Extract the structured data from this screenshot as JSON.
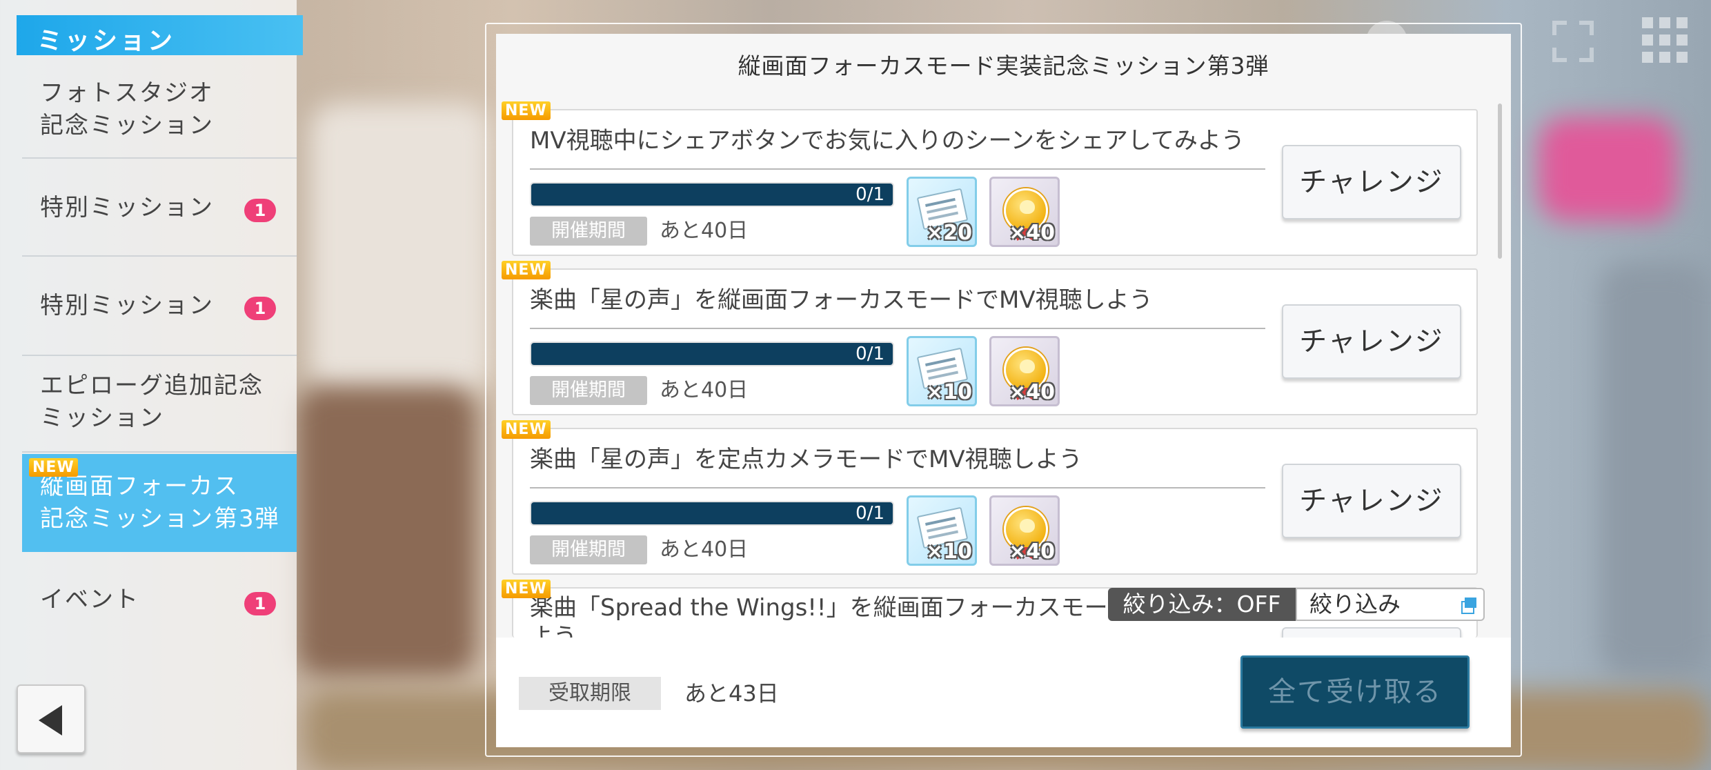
{
  "sidebar": {
    "header": "ミッション",
    "items": [
      {
        "label_lines": [
          "フォトスタジオ",
          "記念ミッション"
        ],
        "badge": null,
        "new": false
      },
      {
        "label_lines": [
          "特別ミッション"
        ],
        "badge": "1",
        "new": false
      },
      {
        "label_lines": [
          "特別ミッション"
        ],
        "badge": "1",
        "new": false
      },
      {
        "label_lines": [
          "エピローグ追加記念",
          "ミッション"
        ],
        "badge": null,
        "new": false
      },
      {
        "label_lines": [
          "縦画面フォーカス",
          "記念ミッション第3弾"
        ],
        "badge": null,
        "new": true
      },
      {
        "label_lines": [
          "イベント"
        ],
        "badge": "1",
        "new": false
      }
    ],
    "new_label": "NEW"
  },
  "panel": {
    "title": "縦画面フォーカスモード実装記念ミッション第3弾",
    "missions": [
      {
        "new": "NEW",
        "title": "MV視聴中にシェアボタンでお気に入りのシーンをシェアしてみよう",
        "progress": "0/1",
        "progress_fraction": 1.0,
        "period_label": "開催期間",
        "period_value": "あと40日",
        "rewards": [
          {
            "icon": "ticket-icon",
            "qty": "×20"
          },
          {
            "icon": "coin-icon",
            "qty": "×40"
          }
        ],
        "button": "チャレンジ"
      },
      {
        "new": "NEW",
        "title": "楽曲「星の声」を縦画面フォーカスモードでMV視聴しよう",
        "progress": "0/1",
        "progress_fraction": 1.0,
        "period_label": "開催期間",
        "period_value": "あと40日",
        "rewards": [
          {
            "icon": "ticket-icon",
            "qty": "×10"
          },
          {
            "icon": "coin-icon",
            "qty": "×40"
          }
        ],
        "button": "チャレンジ"
      },
      {
        "new": "NEW",
        "title": "楽曲「星の声」を定点カメラモードでMV視聴しよう",
        "progress": "0/1",
        "progress_fraction": 1.0,
        "period_label": "開催期間",
        "period_value": "あと40日",
        "rewards": [
          {
            "icon": "ticket-icon",
            "qty": "×10"
          },
          {
            "icon": "coin-icon",
            "qty": "×40"
          }
        ],
        "button": "チャレンジ"
      },
      {
        "new": "NEW",
        "title": "楽曲「Spread the Wings!!」を縦画面フォーカスモー",
        "title_line2": "よう"
      }
    ],
    "filter": {
      "status": "絞り込み：OFF",
      "button": "絞り込み"
    },
    "footer": {
      "deadline_label": "受取期限",
      "deadline_value": "あと43日",
      "claim_all": "全て受け取る"
    }
  },
  "colors": {
    "accent": "#1ea7ea",
    "progress_fill": "#0d3f5f",
    "badge": "#ef3f78",
    "claim_button": "#0f4a66"
  }
}
